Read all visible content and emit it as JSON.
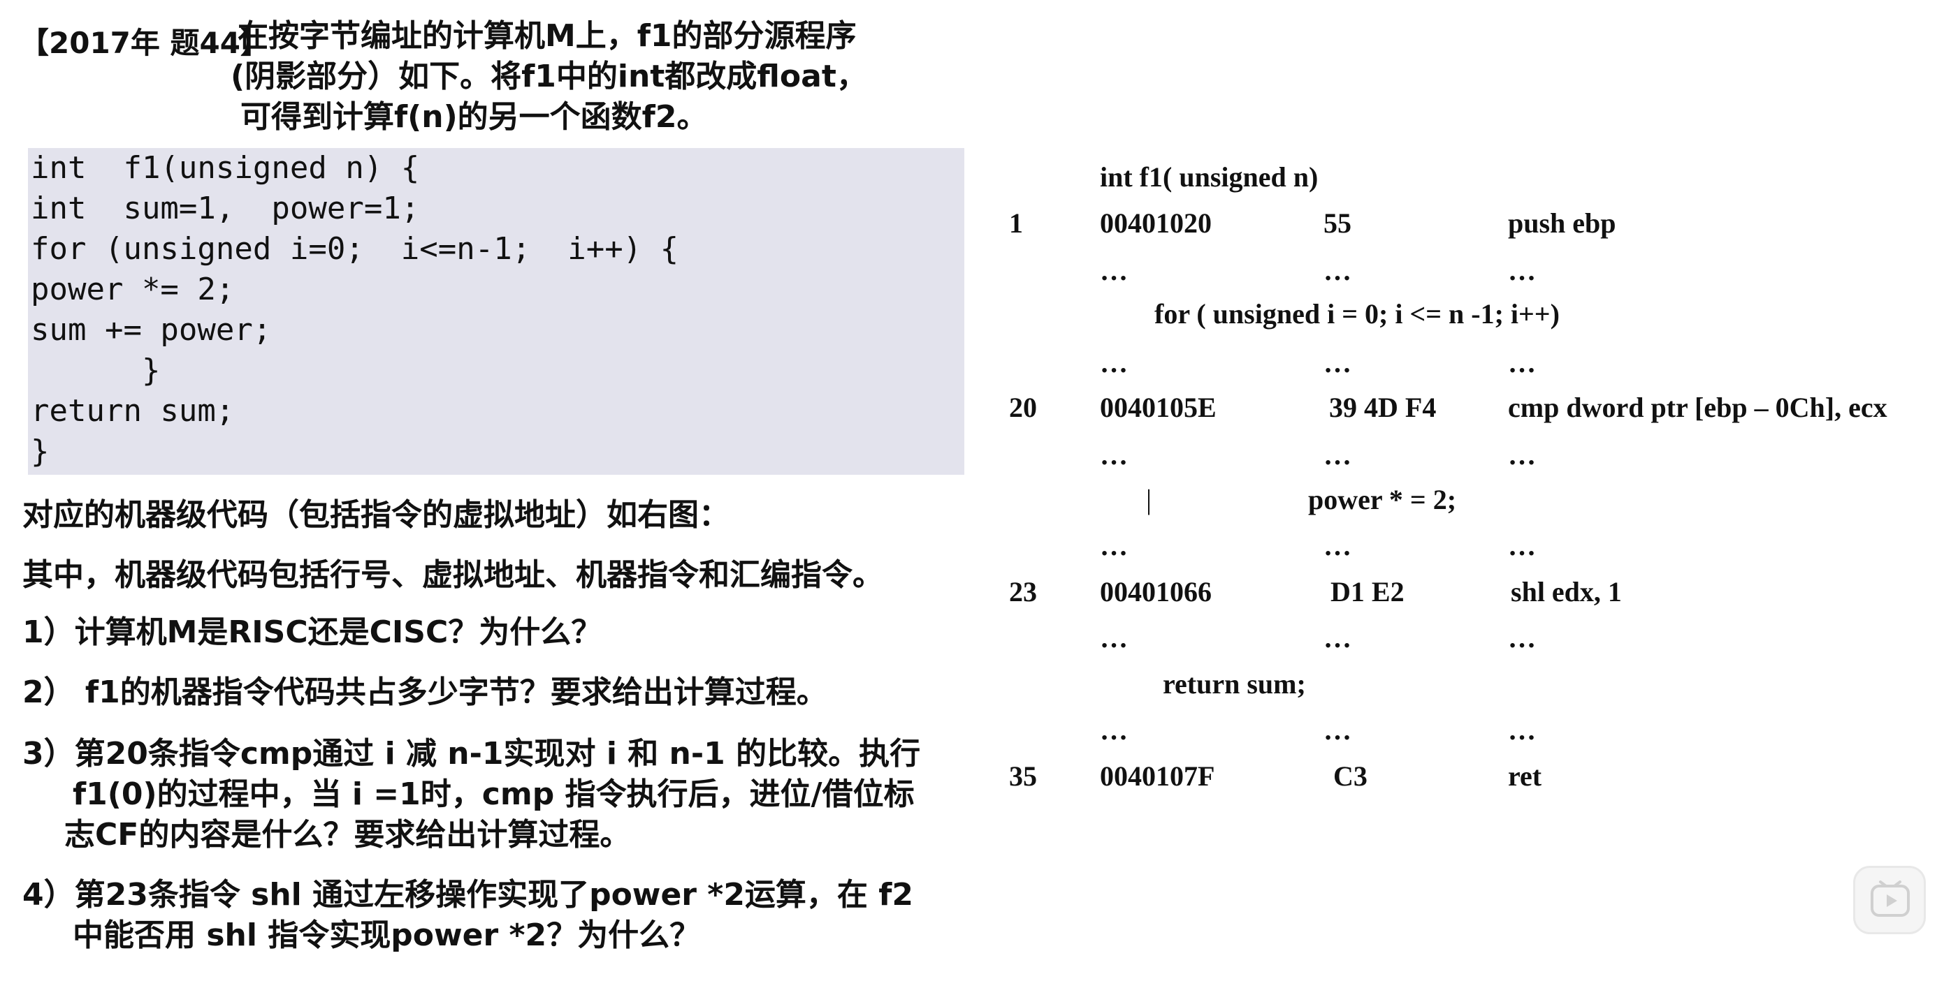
{
  "header": {
    "tag": "【2017年 题44】",
    "lines": [
      "在按字节编址的计算机M上，f1的部分源程序",
      "(阴影部分）如下。将f1中的int都改成float，",
      "可得到计算f(n)的另一个函数f2。"
    ]
  },
  "code": {
    "lines": [
      "int  f1(unsigned n) {",
      "int  sum=1,  power=1;",
      "for (unsigned i=0;  i<=n-1;  i++) {",
      "power *= 2;",
      "sum += power;",
      "      }",
      "return sum;",
      "}"
    ]
  },
  "body": {
    "intro1": "对应的机器级代码（包括指令的虚拟地址）如右图：",
    "intro2": "其中，机器级代码包括行号、虚拟地址、机器指令和汇编指令。",
    "q1": "1）计算机M是RISC还是CISC？为什么？",
    "q2": "2）  f1的机器指令代码共占多少字节？要求给出计算过程。",
    "q3_line1": "3）第20条指令cmp通过 i 减 n-1实现对 i 和 n-1 的比较。执行",
    "q3_line2": "f1(0)的过程中，当 i =1时，cmp 指令执行后，进位/借位标",
    "q3_line3": "志CF的内容是什么？要求给出计算过程。",
    "q4_line1": "4）第23条指令 shl 通过左移操作实现了power *2运算，在 f2",
    "q4_line2": "中能否用 shl 指令实现power *2？为什么？"
  },
  "asm": {
    "header": "int  f1( unsigned n)",
    "row1": {
      "num": "1",
      "addr": "00401020",
      "code": "55",
      "instr": "push ebp"
    },
    "ell1": [
      "…",
      "…",
      "…"
    ],
    "for_src": "for ( unsigned i = 0;  i <= n -1;  i++)",
    "ell2": [
      "…",
      "…",
      "…"
    ],
    "row20": {
      "num": "20",
      "addr": "0040105E",
      "code": "39 4D F4",
      "instr": "cmp dword ptr [ebp – 0Ch], ecx"
    },
    "ell3": [
      "…",
      "…",
      "…"
    ],
    "bar": "|",
    "power_src": "power * = 2;",
    "ell4": [
      "…",
      "…",
      "…"
    ],
    "row23": {
      "num": "23",
      "addr": "00401066",
      "code": "D1 E2",
      "instr": "shl  edx, 1"
    },
    "ell5": [
      "…",
      "…",
      "…"
    ],
    "return_src": "return sum;",
    "ell6": [
      "…",
      "…",
      "…"
    ],
    "row35": {
      "num": "35",
      "addr": "0040107F",
      "code": "C3",
      "instr": "ret"
    }
  },
  "icons": {
    "play": "play-icon"
  }
}
